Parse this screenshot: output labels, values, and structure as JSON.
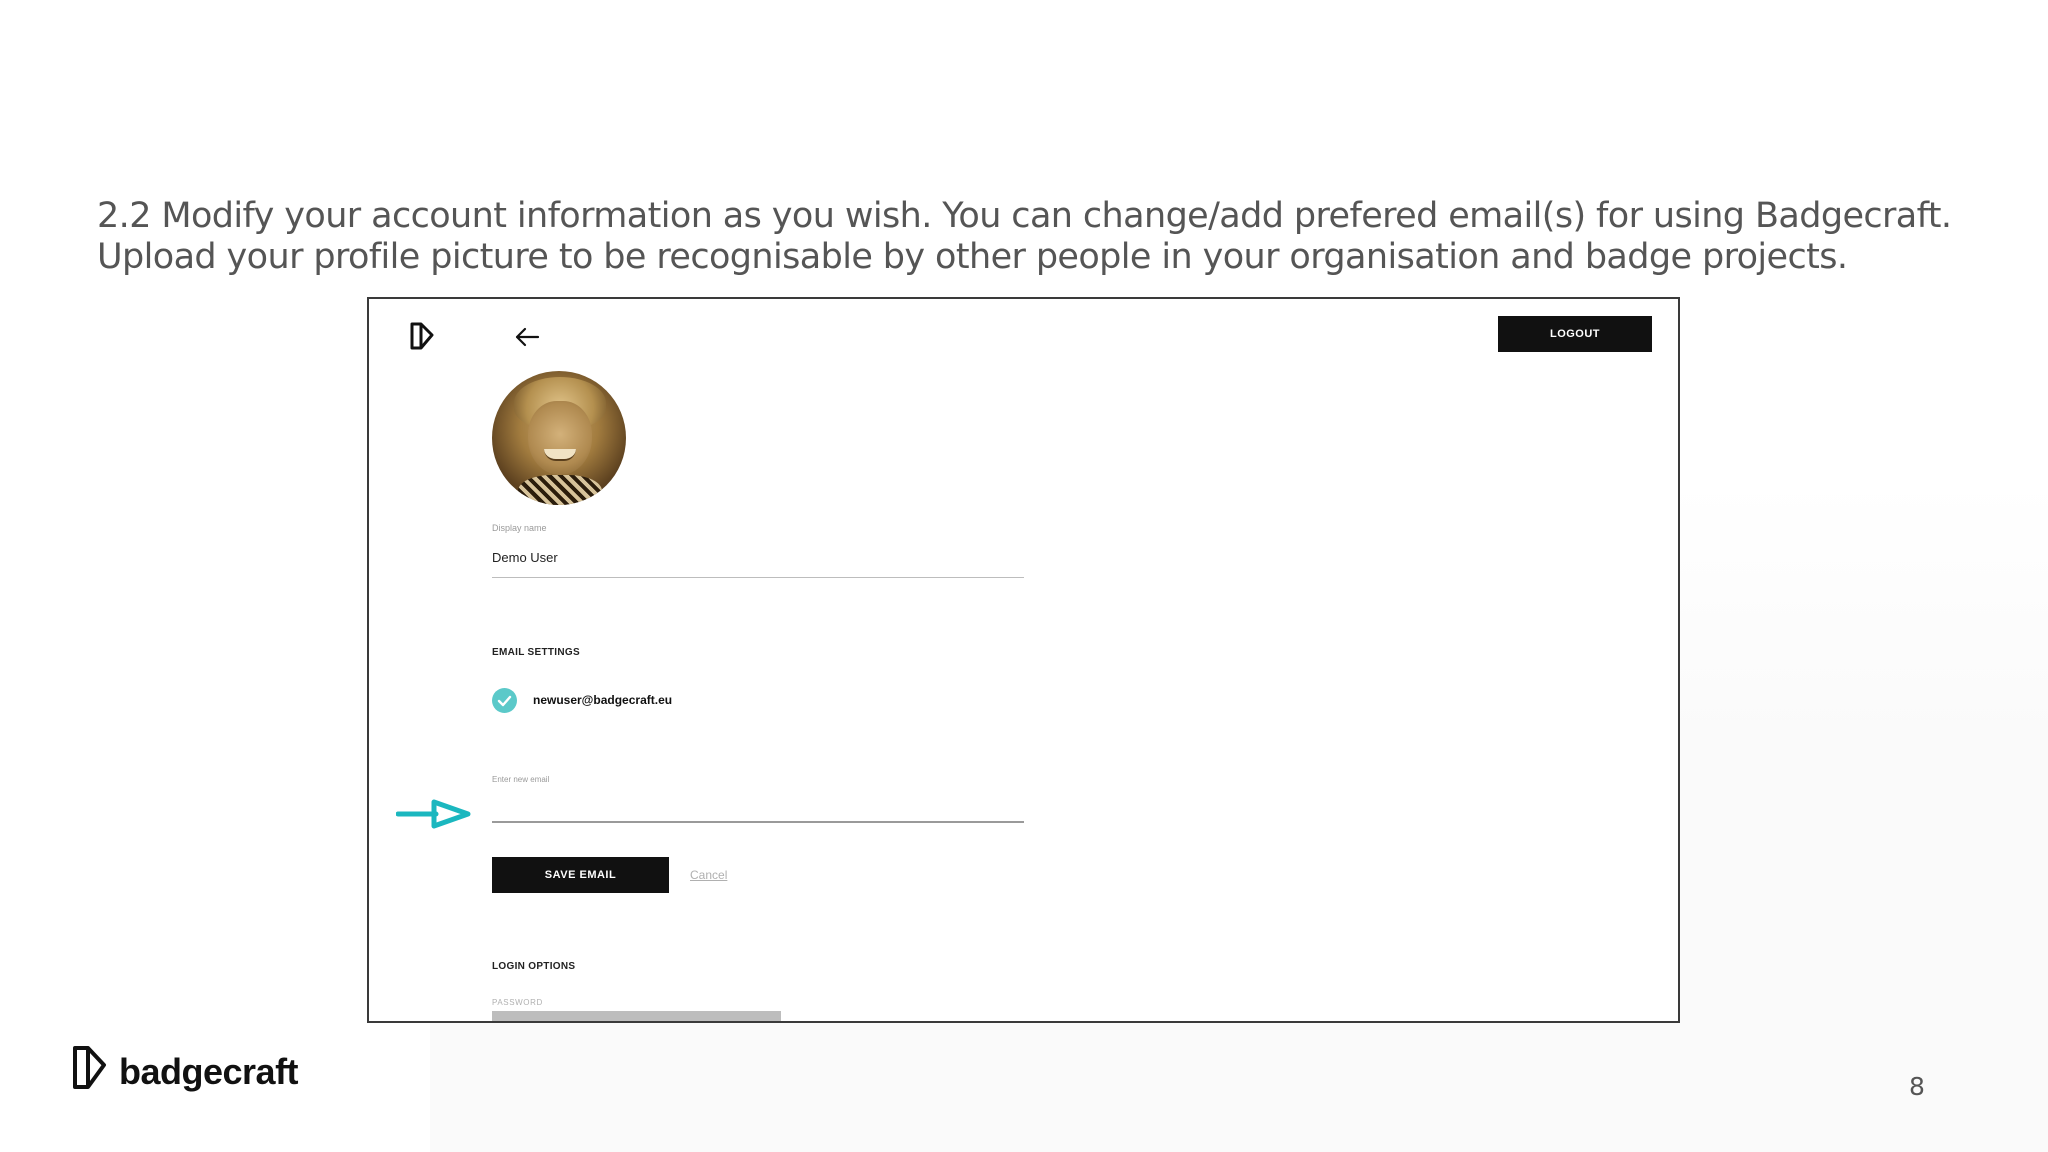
{
  "slide": {
    "instruction": "2.2 Modify your account information as you wish. You can change/add prefered email(s) for using Badgecraft. Upload your profile picture to be recognisable by other people in your organisation and badge projects.",
    "page_number": "8",
    "brand_name": "badgecraft"
  },
  "app": {
    "logout_label": "LOGOUT",
    "display_name_label": "Display name",
    "display_name_value": "Demo User",
    "email_settings_title": "EMAIL SETTINGS",
    "verified_email": "newuser@badgecraft.eu",
    "new_email_placeholder": "Enter new email",
    "save_email_label": "SAVE EMAIL",
    "cancel_label": "Cancel",
    "login_options_title": "LOGIN OPTIONS",
    "password_label": "PASSWORD"
  },
  "colors": {
    "accent_teal": "#1bb7bf",
    "check_teal": "#5bc9c9",
    "button_black": "#111111",
    "instruction_gray": "#555555"
  },
  "icons": [
    "badgecraft-logo-icon",
    "back-arrow-icon",
    "checkmark-icon",
    "pointer-arrow-icon"
  ]
}
